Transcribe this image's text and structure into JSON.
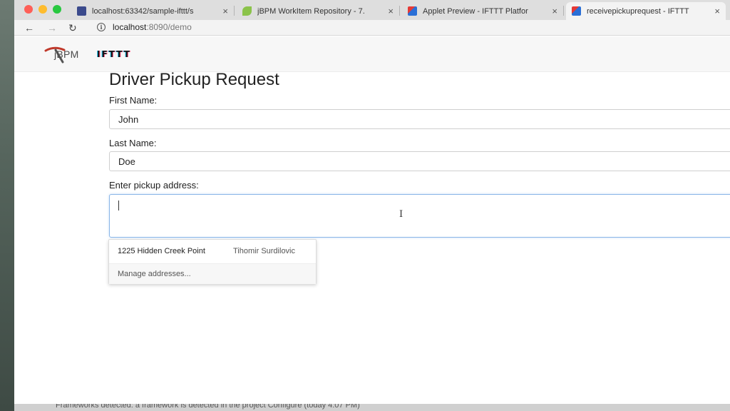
{
  "browser": {
    "tabs": [
      {
        "title": "localhost:63342/sample-ifttt/s",
        "favicon_color": "#3b4a8c"
      },
      {
        "title": "jBPM WorkItem Repository - 7.",
        "favicon_color": "#8bc34a"
      },
      {
        "title": "Applet Preview - IFTTT Platfor",
        "favicon_color": "#2a6fd6"
      },
      {
        "title": "receivepickuprequest - IFTTT",
        "favicon_color": "#2a6fd6"
      }
    ],
    "tab_close_glyph": "×",
    "url_host": "localhost",
    "url_rest": ":8090/demo",
    "nav": {
      "back": "←",
      "forward": "→",
      "reload": "↻",
      "info": "i"
    }
  },
  "header": {
    "jbpm_label": "jBPM",
    "ifttt_label": "IFTTT"
  },
  "form": {
    "title": "Driver Pickup Request",
    "first_name_label": "First Name:",
    "first_name_value": "John",
    "last_name_label": "Last Name:",
    "last_name_value": "Doe",
    "address_label": "Enter pickup address:",
    "address_value": ""
  },
  "autocomplete": {
    "address": "1225 Hidden Creek Point",
    "name": "Tihomir Surdilovic",
    "manage": "Manage addresses..."
  },
  "bottom_bar": {
    "text": "Frameworks detected: a framework is detected in the project Configure (today 4:07 PM)"
  },
  "colors": {
    "focus_border": "#8ab6e8",
    "traffic_red": "#fe5f57",
    "traffic_yellow": "#febc2e",
    "traffic_green": "#28c840"
  }
}
